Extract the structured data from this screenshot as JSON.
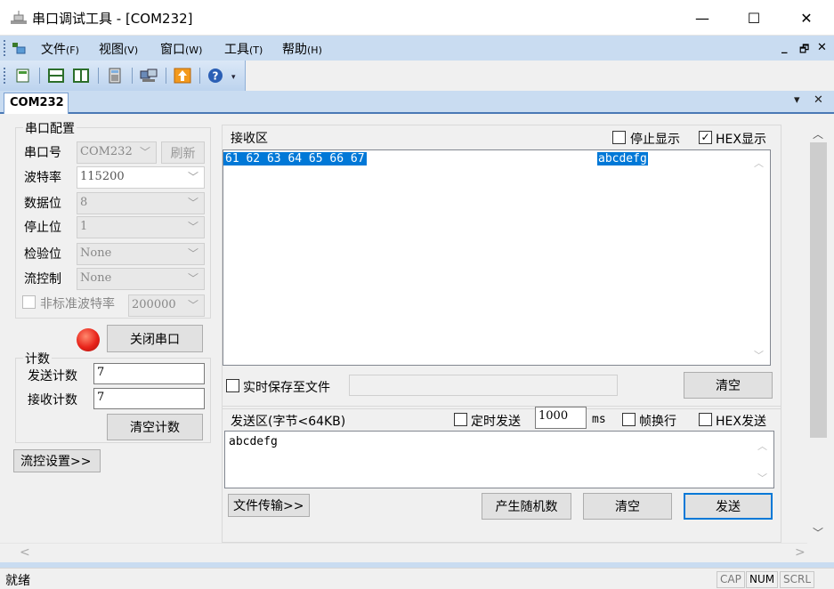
{
  "window": {
    "title": "串口调试工具 - [COM232]",
    "minimize": "—",
    "maximize": "☐",
    "close": "✕"
  },
  "menu": {
    "items": [
      {
        "label": "文件",
        "key": "(F)"
      },
      {
        "label": "视图",
        "key": "(V)"
      },
      {
        "label": "窗口",
        "key": "(W)"
      },
      {
        "label": "工具",
        "key": "(T)"
      },
      {
        "label": "帮助",
        "key": "(H)"
      }
    ],
    "mdi_min": "_",
    "mdi_restore": "🗗",
    "mdi_close": "✕"
  },
  "tab": {
    "label": "COM232",
    "dropdown": "▾",
    "close": "✕"
  },
  "serial_config": {
    "title": "串口配置",
    "port_label": "串口号",
    "port_value": "COM232",
    "refresh_label": "刷新",
    "baud_label": "波特率",
    "baud_value": "115200",
    "data_bits_label": "数据位",
    "data_bits_value": "8",
    "stop_bits_label": "停止位",
    "stop_bits_value": "1",
    "parity_label": "检验位",
    "parity_value": "None",
    "flow_label": "流控制",
    "flow_value": "None",
    "nonstd_label": "非标准波特率",
    "nonstd_value": "200000",
    "close_port_label": "关闭串口"
  },
  "counter": {
    "title": "计数",
    "send_label": "发送计数",
    "send_value": "7",
    "recv_label": "接收计数",
    "recv_value": "7",
    "clear_label": "清空计数"
  },
  "flow_settings_label": "流控设置>>",
  "receive": {
    "title": "接收区",
    "stop_display_label": "停止显示",
    "hex_display_label": "HEX显示",
    "hex_data": "61 62 63 64 65 66 67 ",
    "ascii_data": "abcdefg",
    "save_to_file_label": "实时保存至文件",
    "clear_label": "清空"
  },
  "send": {
    "title": "发送区(字节<64KB)",
    "timed_send_label": "定时发送",
    "interval_value": "1000",
    "interval_unit": "ms",
    "line_break_label": "帧换行",
    "hex_send_label": "HEX发送",
    "content": "abcdefg",
    "file_transfer_label": "文件传输>>",
    "random_label": "产生随机数",
    "clear_label": "清空",
    "send_label": "发送"
  },
  "status": {
    "text": "就绪",
    "cap": "CAP",
    "num": "NUM",
    "scrl": "SCRL"
  },
  "colors": {
    "accent": "#0078d7",
    "selection": "#0078d7",
    "menubar": "#c9dcf1",
    "led": "#e8231a"
  }
}
